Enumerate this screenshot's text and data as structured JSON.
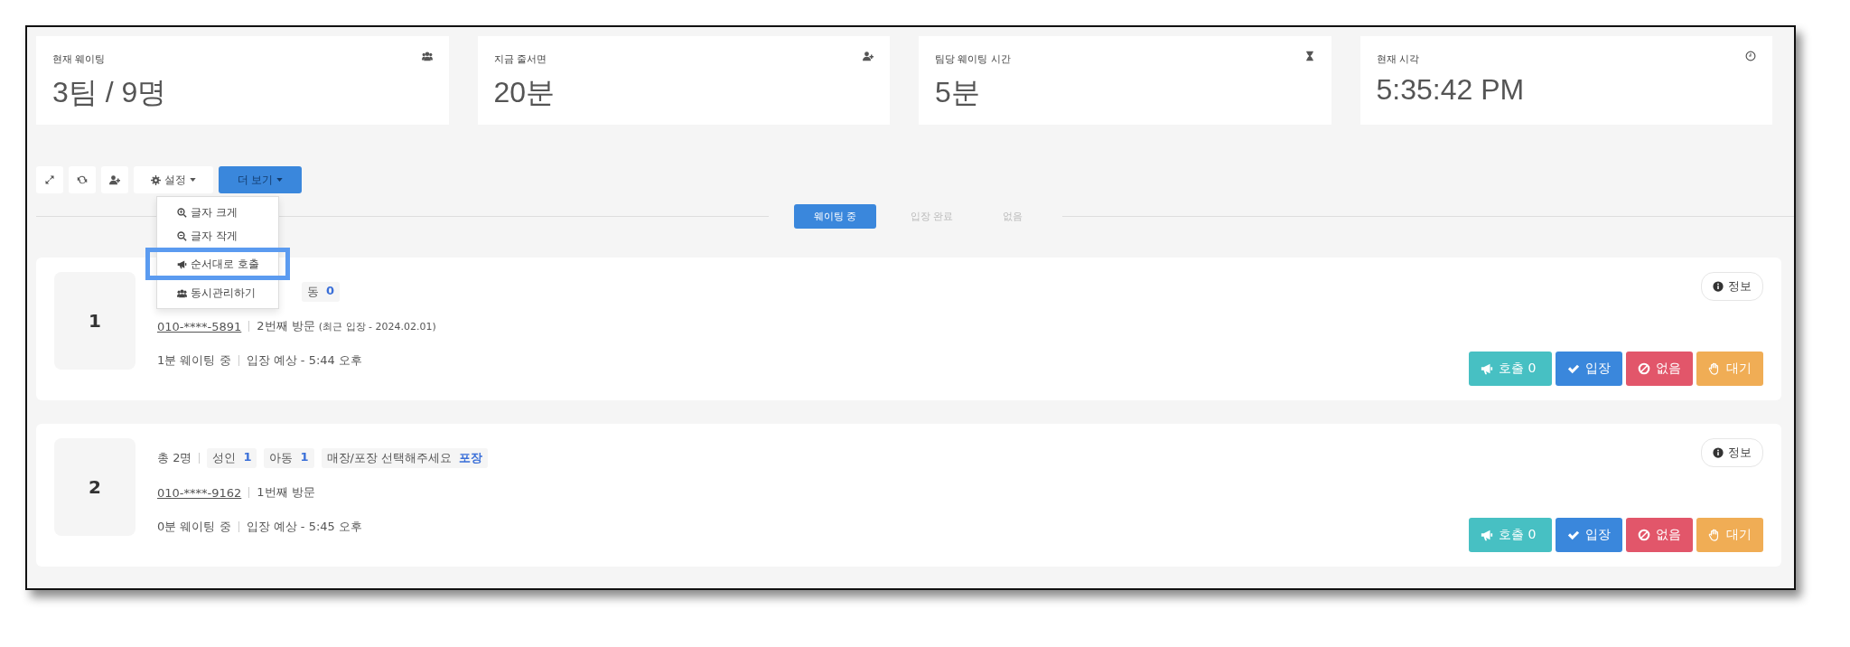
{
  "stats": [
    {
      "label": "현재 웨이팅",
      "value": "3팀 / 9명"
    },
    {
      "label": "지금 줄서면",
      "value": "20분"
    },
    {
      "label": "팀당 웨이팅 시간",
      "value": "5분"
    },
    {
      "label": "현재 시각",
      "value": "5:35:42 PM"
    }
  ],
  "toolbar": {
    "settings_label": "설정",
    "more_label": "더 보기"
  },
  "settings_menu": {
    "open": true,
    "items": [
      {
        "label": "글자 크게",
        "selected": false
      },
      {
        "label": "글자 작게",
        "selected": false
      },
      {
        "label": "순서대로 호출",
        "selected": true
      },
      {
        "label": "동시관리하기",
        "selected": false
      }
    ]
  },
  "tabs": [
    {
      "label": "웨이팅 중",
      "selected": true
    },
    {
      "label": "입장 완료",
      "selected": false
    },
    {
      "label": "없음",
      "selected": false
    }
  ],
  "rows": [
    {
      "number": "1",
      "line1": [
        {
          "kind": "chip",
          "label": "동",
          "count": "0"
        }
      ],
      "phone": "010-****-5891",
      "visit": "2번째 방문",
      "visit_note": "(최근 입장 - 2024.02.01)",
      "waiting": "1분 웨이팅 중",
      "expected": "입장 예상 - 5:44 오후",
      "info": "정보",
      "buttons": [
        {
          "kind": "call",
          "label": "호출 0"
        },
        {
          "kind": "enter",
          "label": "입장"
        },
        {
          "kind": "absent",
          "label": "없음"
        },
        {
          "kind": "hold",
          "label": "대기"
        }
      ]
    },
    {
      "number": "2",
      "line1": [
        {
          "kind": "total",
          "label": "총 2명"
        },
        {
          "kind": "chip",
          "label": "성인",
          "count": "1"
        },
        {
          "kind": "chip",
          "label": "아동",
          "count": "1"
        },
        {
          "kind": "chip",
          "label": "매장/포장 선택해주세요",
          "count": "포장"
        }
      ],
      "phone": "010-****-9162",
      "visit": "1번째 방문",
      "waiting": "0분 웨이팅 중",
      "expected": "입장 예상 - 5:45 오후",
      "info": "정보",
      "buttons": [
        {
          "kind": "call",
          "label": "호출 0"
        },
        {
          "kind": "enter",
          "label": "입장"
        },
        {
          "kind": "absent",
          "label": "없음"
        },
        {
          "kind": "hold",
          "label": "대기"
        }
      ]
    }
  ]
}
